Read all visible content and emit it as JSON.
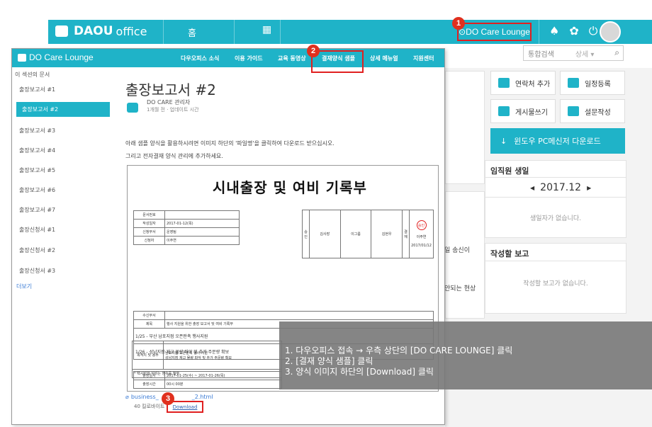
{
  "app": {
    "logo_bold": "DAOU",
    "logo_light": "office",
    "home": "홈",
    "grid_icon": "grid-icon",
    "do_care_link": "DO Care Lounge",
    "icons": [
      "bell-icon",
      "gear-icon",
      "power-icon"
    ]
  },
  "badges": [
    "1",
    "2",
    "3"
  ],
  "search": {
    "placeholder": "통합검색",
    "option": "상세 ▾"
  },
  "right_panel": {
    "buttons": [
      "연락처 추가",
      "일정등록",
      "게시물쓰기",
      "설문작성"
    ],
    "download": "윈도우 PC메신저 다운로드",
    "birthday_title": "임직원 생일",
    "birthday_month": "2017.12",
    "birthday_empty": "생일자가 없습니다.",
    "report_title": "작성할 보고",
    "report_empty": "작성할 보고가 없습니다."
  },
  "mid_fragments": [
    "일 송신이",
    "안되는 현상"
  ],
  "window": {
    "title": "DO Care Lounge",
    "nav": [
      "다우오피스 소식",
      "이용 가이드",
      "교육 동영상",
      "결재양식 샘플",
      "상세 메뉴얼",
      "지원센터"
    ],
    "highlight_nav_index": 3
  },
  "sidebar": {
    "heading": "이 섹션의 문서",
    "items": [
      "출장보고서 #1",
      "출장보고서 #2",
      "출장보고서 #3",
      "출장보고서 #4",
      "출장보고서 #5",
      "출장보고서 #6",
      "출장보고서 #7",
      "출장신청서 #1",
      "출장신청서 #2",
      "출장신청서 #3"
    ],
    "active_index": 1,
    "more": "더보기"
  },
  "doc": {
    "title": "출장보고서 #2",
    "author": "DO CARE 관리자",
    "meta": "1개월 전 · 업데이트 시간",
    "instr1": "아래 샘플 양식을 활용하시려면 이미지 하단의 '파일명'을 클릭하여 다운로드 받으십시오.",
    "instr2": "그리고 전자결재 양식 관리에 추가하세요."
  },
  "form": {
    "title": "시내출장 및 여비 기록부",
    "info": [
      {
        "label": "문서번호",
        "value": ""
      },
      {
        "label": "작성일자",
        "value": "2017-01-12(목)"
      },
      {
        "label": "신청부서",
        "value": "운영팀"
      },
      {
        "label": "신청자",
        "value": "이주연"
      }
    ],
    "approval_side": "승인",
    "approvers": [
      "김사장",
      "이그룹",
      "김현우"
    ],
    "approve_side": "결재",
    "stamp": "승인",
    "approver_name": "이주연",
    "approver_date": "2017/01/12",
    "recv_label": "수신부서",
    "subject_label": "제목",
    "subject": "행사 지원을 위한 출장 보고서 및 여비 기록부",
    "line1": "1/25 - 부산 남포지점 오픈판촉 행사지원",
    "line2": "1/26 - 성남지점 재고 물량 파악 및 추가 주문량 확보",
    "date_label": "출장일자",
    "date_value": "2017-01-25(수) ~ 2017-01-26(목)",
    "time_label": "출장시간",
    "time_value": "00시 00분",
    "purpose_label": "목적지 및 용무",
    "purpose_value1": "남포지점 오픈판촉 행사 지원",
    "purpose_value2": "성남지점 재고 물량 파악 및 추가 주문량 확보",
    "note": "* 택시비와 식비는 영수증 첨부"
  },
  "attachment": {
    "name": "business_",
    "suffix": "_2.html",
    "size": "40 킬로바이트",
    "download": "Download"
  },
  "tooltip": [
    "1. 다우오피스 접속 → 우측 상단의 [DO CARE LOUNGE] 클릭",
    "2. [결재 양식 샘플] 클릭",
    "3. 양식 이미지 하단의 [Download] 클릭"
  ]
}
